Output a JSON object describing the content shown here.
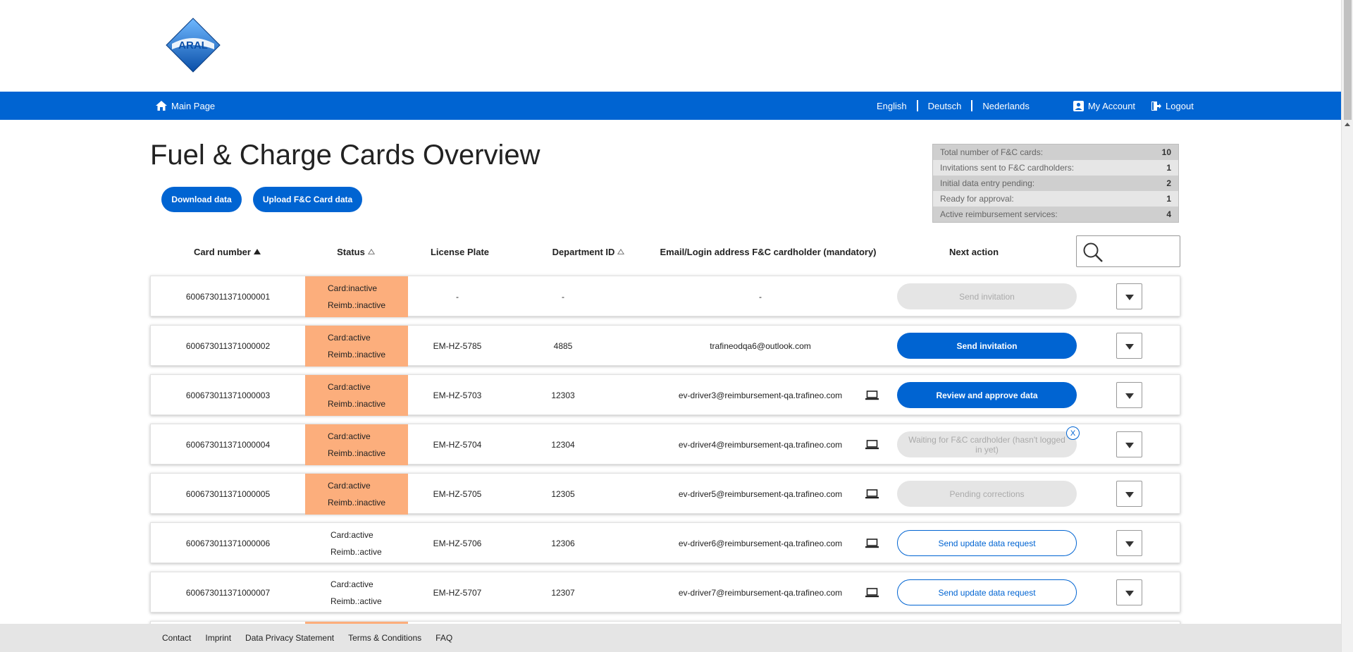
{
  "brand": {
    "logo_text": "ARAL",
    "primary_color": "#0064d2",
    "status_inactive_color": "#fcae7c"
  },
  "nav": {
    "home": "Main Page",
    "languages": [
      "English",
      "Deutsch",
      "Nederlands"
    ],
    "account": "My Account",
    "logout": "Logout"
  },
  "page": {
    "title": "Fuel & Charge Cards Overview",
    "download_btn": "Download data",
    "upload_btn": "Upload F&C Card data"
  },
  "summary": [
    {
      "label": "Total number of F&C cards:",
      "value": "10"
    },
    {
      "label": "Invitations sent to F&C cardholders:",
      "value": "1"
    },
    {
      "label": "Initial data entry pending:",
      "value": "2"
    },
    {
      "label": "Ready for approval:",
      "value": "1"
    },
    {
      "label": "Active reimbursement services:",
      "value": "4"
    }
  ],
  "table": {
    "headers": {
      "card": "Card number",
      "status": "Status",
      "plate": "License Plate",
      "dept": "Department ID",
      "email": "Email/Login address F&C cardholder (mandatory)",
      "next": "Next action"
    },
    "rows": [
      {
        "card": "600673011371000001",
        "card_status": "Card:inactive",
        "reimb_status": "Reimb.:inactive",
        "highlight": true,
        "plate": "-",
        "dept": "-",
        "email": "-",
        "device": false,
        "action": "Send invitation",
        "action_style": "disabled",
        "close": false
      },
      {
        "card": "600673011371000002",
        "card_status": "Card:active",
        "reimb_status": "Reimb.:inactive",
        "highlight": true,
        "plate": "EM-HZ-5785",
        "dept": "4885",
        "email": "trafineodqa6@outlook.com",
        "device": false,
        "action": "Send invitation",
        "action_style": "primary",
        "close": false
      },
      {
        "card": "600673011371000003",
        "card_status": "Card:active",
        "reimb_status": "Reimb.:inactive",
        "highlight": true,
        "plate": "EM-HZ-5703",
        "dept": "12303",
        "email": "ev-driver3@reimbursement-qa.trafineo.com",
        "device": true,
        "action": "Review and approve data",
        "action_style": "primary",
        "close": false
      },
      {
        "card": "600673011371000004",
        "card_status": "Card:active",
        "reimb_status": "Reimb.:inactive",
        "highlight": true,
        "plate": "EM-HZ-5704",
        "dept": "12304",
        "email": "ev-driver4@reimbursement-qa.trafineo.com",
        "device": true,
        "action": "Waiting for F&C cardholder (hasn't logged in yet)",
        "action_style": "disabled",
        "close": true,
        "close_label": "X"
      },
      {
        "card": "600673011371000005",
        "card_status": "Card:active",
        "reimb_status": "Reimb.:inactive",
        "highlight": true,
        "plate": "EM-HZ-5705",
        "dept": "12305",
        "email": "ev-driver5@reimbursement-qa.trafineo.com",
        "device": true,
        "action": "Pending corrections",
        "action_style": "disabled",
        "close": false
      },
      {
        "card": "600673011371000006",
        "card_status": "Card:active",
        "reimb_status": "Reimb.:active",
        "highlight": false,
        "plate": "EM-HZ-5706",
        "dept": "12306",
        "email": "ev-driver6@reimbursement-qa.trafineo.com",
        "device": true,
        "action": "Send update data request",
        "action_style": "outline",
        "close": false
      },
      {
        "card": "600673011371000007",
        "card_status": "Card:active",
        "reimb_status": "Reimb.:active",
        "highlight": false,
        "plate": "EM-HZ-5707",
        "dept": "12307",
        "email": "ev-driver7@reimbursement-qa.trafineo.com",
        "device": true,
        "action": "Send update data request",
        "action_style": "outline",
        "close": false
      }
    ]
  },
  "footer": [
    "Contact",
    "Imprint",
    "Data Privacy Statement",
    "Terms & Conditions",
    "FAQ"
  ]
}
